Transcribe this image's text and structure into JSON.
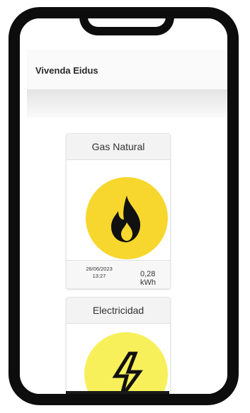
{
  "app": {
    "title": "Vivenda Eidus"
  },
  "cards": [
    {
      "title": "Gas Natural",
      "icon": "flame-icon",
      "color": "#f7d72e",
      "reading": {
        "date": "26/06/2023",
        "time": "13:27",
        "value": "0,28 kWh"
      }
    },
    {
      "title": "Electricidad",
      "icon": "lightning-icon",
      "color": "#f7f05a"
    }
  ]
}
